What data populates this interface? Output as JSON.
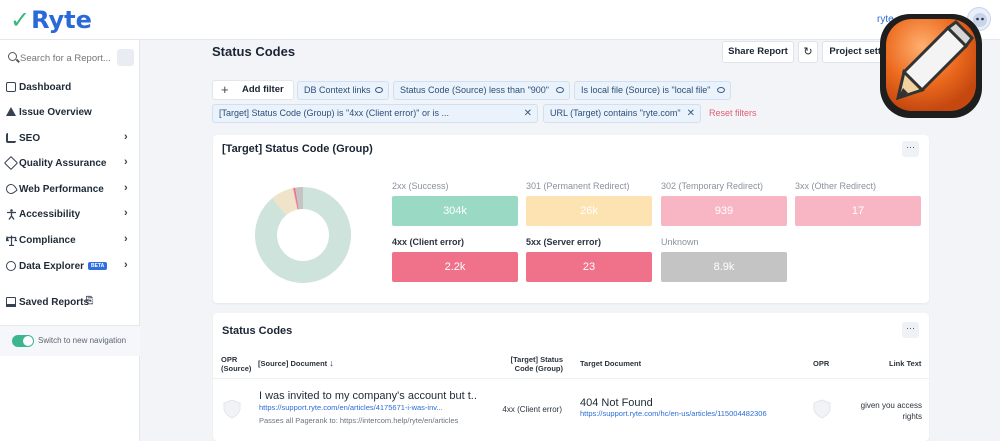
{
  "app": {
    "logo": "Ryte",
    "user_link": "ryte.com"
  },
  "search": {
    "placeholder": "Search for a Report..."
  },
  "sidebar": {
    "items": [
      {
        "label": "Dashboard",
        "chevron": ""
      },
      {
        "label": "Issue Overview",
        "chevron": ""
      },
      {
        "label": "SEO",
        "chevron": "›"
      },
      {
        "label": "Quality Assurance",
        "chevron": "›"
      },
      {
        "label": "Web Performance",
        "chevron": "›"
      },
      {
        "label": "Accessibility",
        "chevron": "›"
      },
      {
        "label": "Compliance",
        "chevron": "›"
      },
      {
        "label": "Data Explorer",
        "badge": "BETA",
        "chevron": "›"
      },
      {
        "label": "Saved Reports",
        "chevron": ""
      }
    ],
    "toggle_label": "Switch to new navigation",
    "toggle_on": true
  },
  "header": {
    "title": "Status Codes",
    "share_label": "Share Report",
    "refresh_icon": "↻",
    "settings_label": "Project settings"
  },
  "filters": {
    "add_label": "Add filter",
    "chips": [
      "DB Context links",
      "Status Code (Source) less than \"900\"",
      "Is local file (Source) is \"local file\"",
      "[Target] Status Code (Group) is \"4xx (Client error)\" or is ...",
      "URL (Target) contains \"ryte.com\""
    ],
    "reset_label": "Reset filters"
  },
  "group_card": {
    "title": "[Target] Status Code (Group)",
    "more": "···",
    "tiles": [
      {
        "label": "2xx (Success)",
        "value": "304k",
        "color": "#9ad9c4"
      },
      {
        "label": "301 (Permanent Redirect)",
        "value": "26k",
        "color": "#fde3b1"
      },
      {
        "label": "302 (Temporary Redirect)",
        "value": "939",
        "color": "#f8b6c5"
      },
      {
        "label": "3xx (Other Redirect)",
        "value": "17",
        "color": "#f8b6c5"
      },
      {
        "label": "4xx (Client error)",
        "value": "2.2k",
        "color": "#f0728a"
      },
      {
        "label": "5xx (Server error)",
        "value": "23",
        "color": "#f0728a"
      },
      {
        "label": "Unknown",
        "value": "8.9k",
        "color": "#c4c4c4"
      }
    ]
  },
  "table_card": {
    "title": "Status Codes",
    "more": "···",
    "columns": [
      "OPR\n(Source)",
      "[Source] Document",
      "[Target] Status\nCode (Group)",
      "Target Document",
      "OPR",
      "Link Text"
    ],
    "sort_icon": "↓",
    "rows": [
      {
        "source_title": "I was invited to my company's account but t...",
        "source_url": "https://support.ryte.com/en/articles/4175671-i-was-inv...",
        "source_note": "Passes all Pagerank to:  https://intercom.help/ryte/en/articles",
        "status_group": "4xx (Client error)",
        "target_title": "404 Not Found",
        "target_url": "https://support.ryte.com/hc/en-us/articles/115004482306",
        "link_text": "given you access\nrights"
      }
    ]
  }
}
